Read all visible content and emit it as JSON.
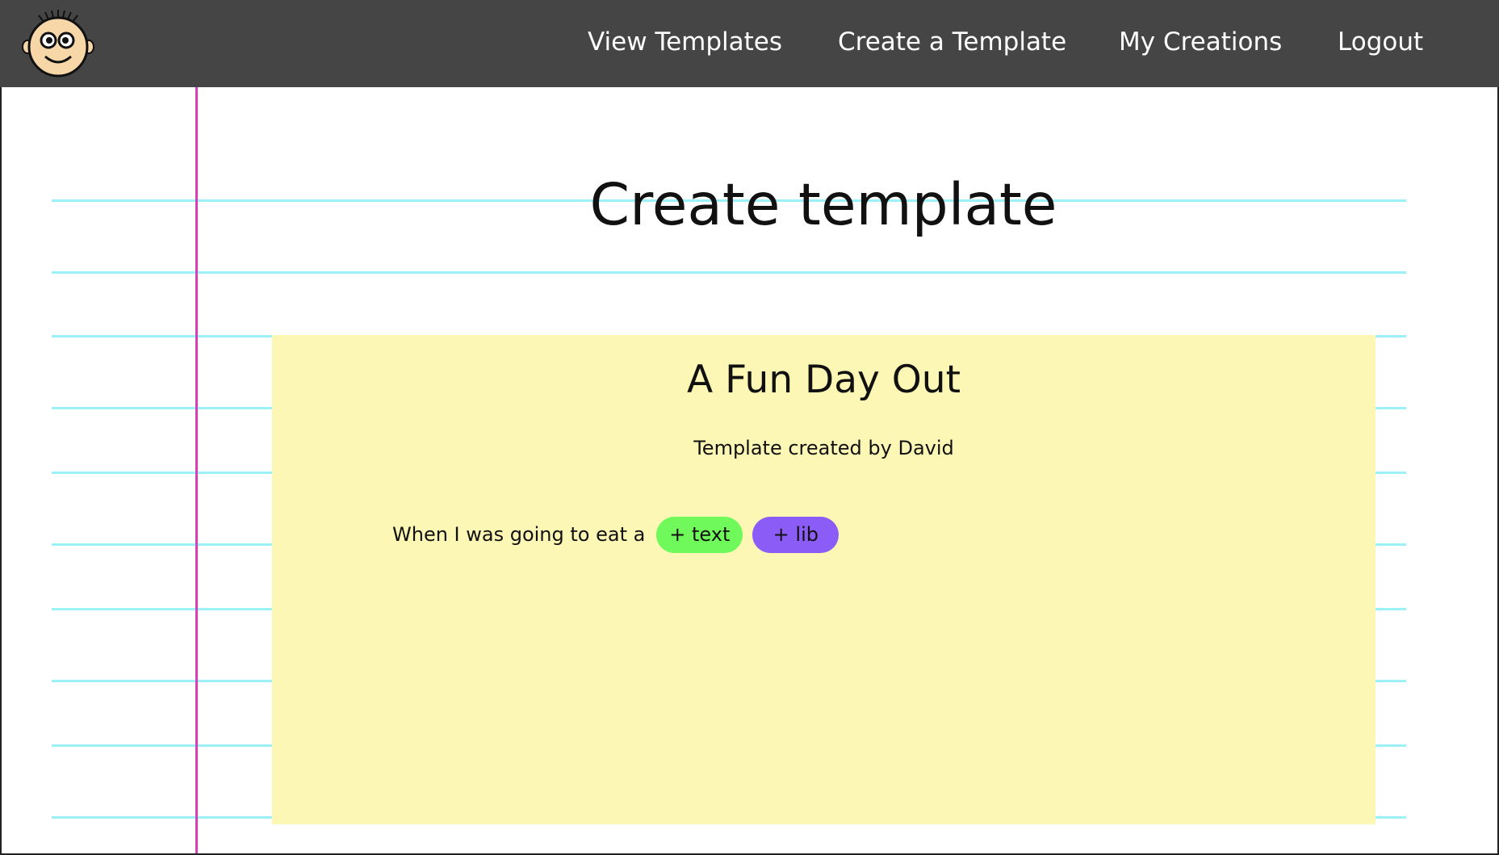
{
  "navbar": {
    "logo_icon": "cartoon-face-logo-icon",
    "links": [
      {
        "label": "View Templates"
      },
      {
        "label": "Create a Template"
      },
      {
        "label": "My Creations"
      },
      {
        "label": "Logout"
      }
    ]
  },
  "page": {
    "title": "Create template"
  },
  "template": {
    "title": "A Fun Day Out",
    "author_line": "Template created by David",
    "sentence": "When I was going to eat a",
    "add_text_label": "+ text",
    "add_lib_label": "+ lib"
  },
  "colors": {
    "navbar": "#454545",
    "rule_lines": "#9cf0f7",
    "margin_line": "#d63fb8",
    "card": "#fdf7b5",
    "text_pill": "#6ff95a",
    "lib_pill": "#8b5cf6"
  }
}
